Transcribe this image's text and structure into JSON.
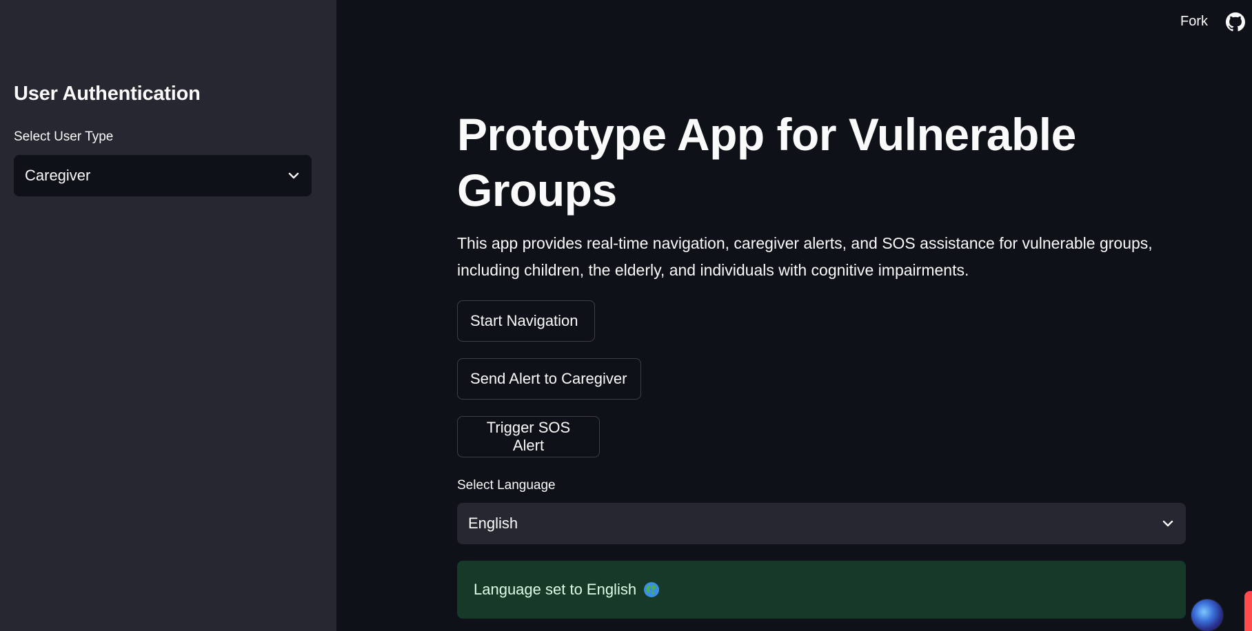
{
  "sidebar": {
    "title": "User Authentication",
    "user_type_label": "Select User Type",
    "user_type_value": "Caregiver",
    "icon": "chevron-down-icon"
  },
  "header": {
    "fork_label": "Fork",
    "github_icon": "github-icon"
  },
  "main": {
    "title": "Prototype App for Vulnerable Groups",
    "description": "This app provides real-time navigation, caregiver alerts, and SOS assistance for vulnerable groups, including children, the elderly, and individuals with cognitive impairments.",
    "buttons": {
      "start_navigation": "Start Navigation",
      "send_alert": "Send Alert to Caregiver",
      "trigger_sos": "Trigger SOS Alert"
    },
    "language_label": "Select Language",
    "language_value": "English",
    "success_message": "Language set to English",
    "success_icon": "globe-icon"
  },
  "colors": {
    "background": "#0e1117",
    "sidebar": "#262730",
    "success_bg": "#173928",
    "success_text": "#dffde9",
    "accent": "#ff4b4b"
  }
}
